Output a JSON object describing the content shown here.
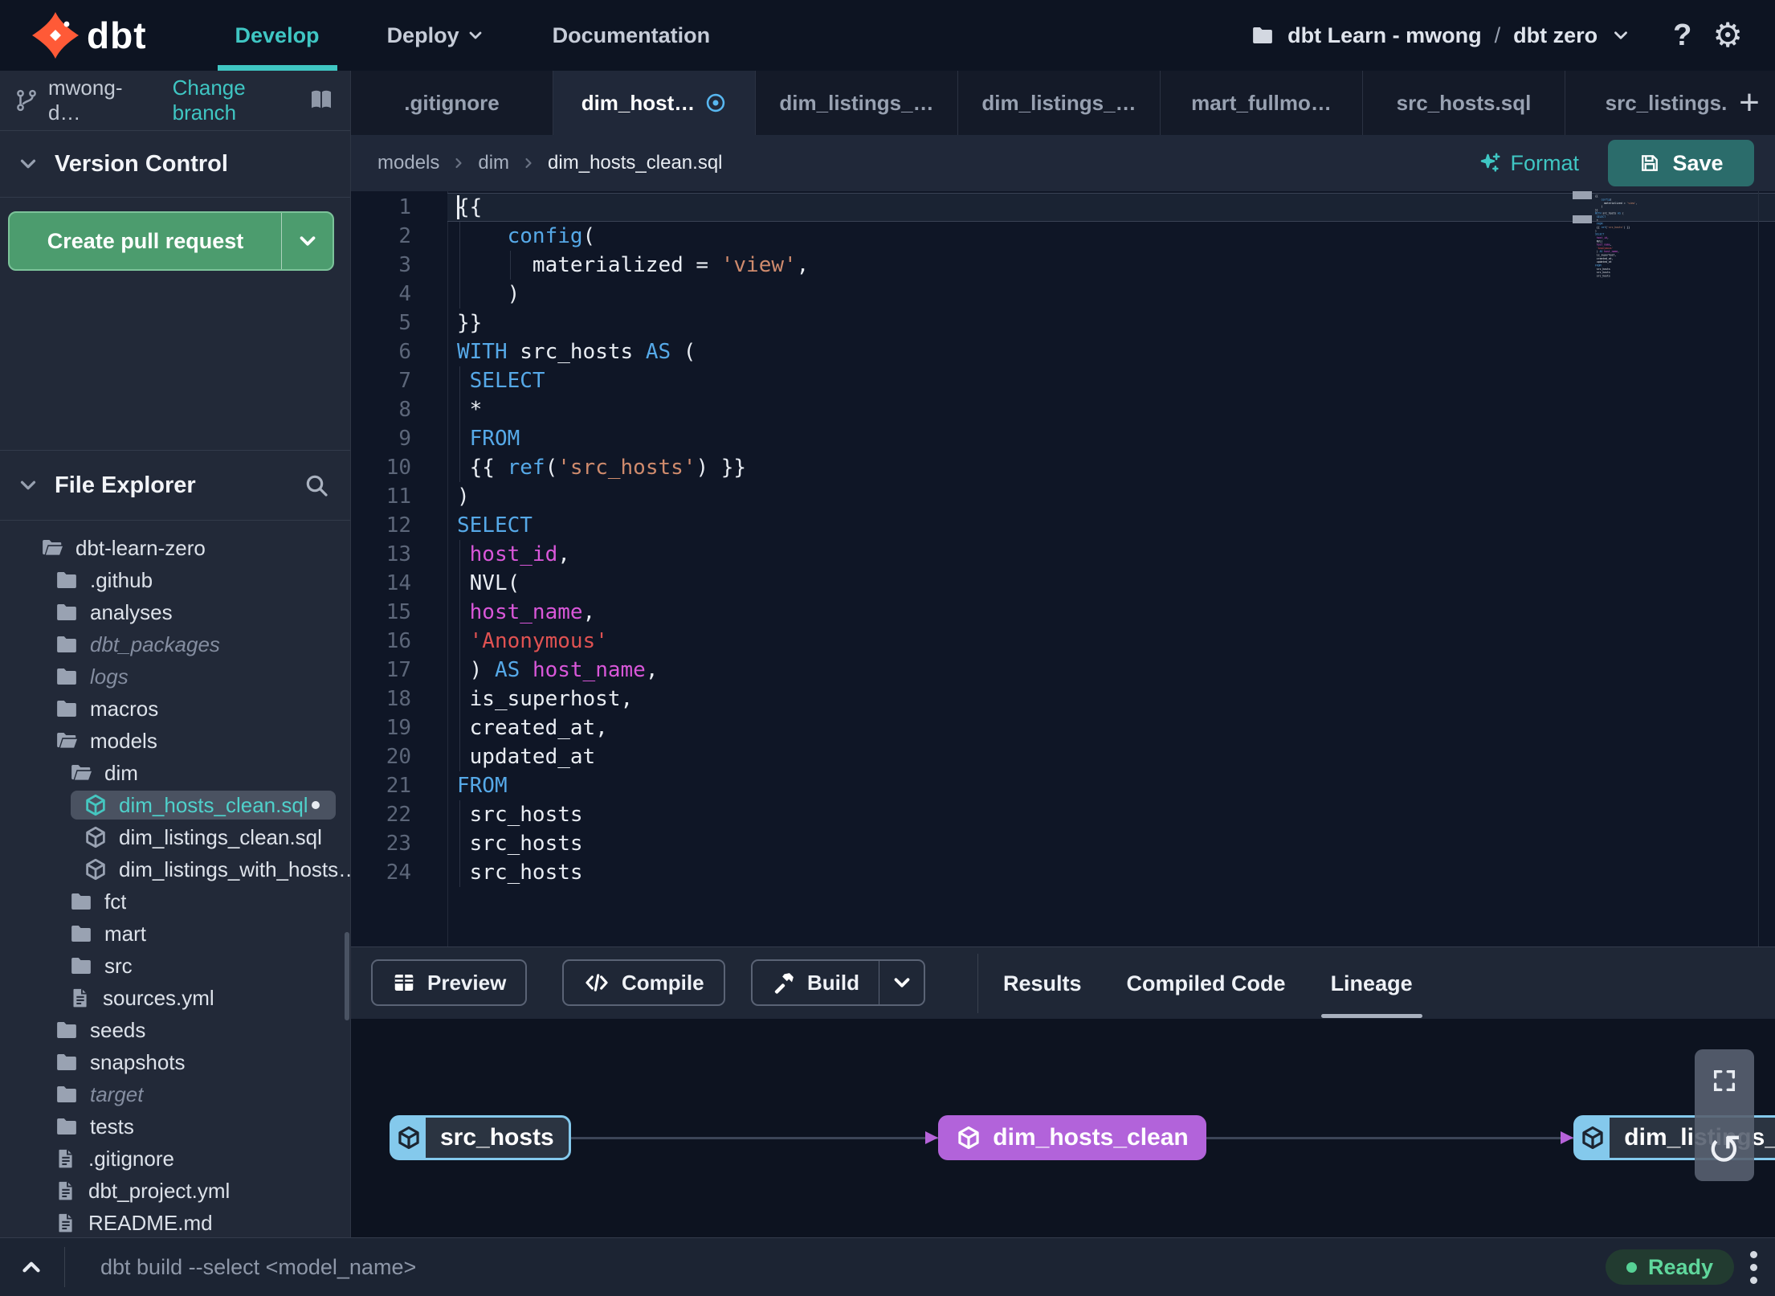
{
  "colors": {
    "accent_teal": "#3fc6c3",
    "brand_orange": "#ff5a37",
    "pr_green": "#4c9c6e",
    "ready_green": "#57d195",
    "node_blue": "#84c9ec",
    "node_purple": "#b263da",
    "modified_blue": "#58b7f0",
    "save_teal": "#2b6c6b"
  },
  "header": {
    "brand": "dbt",
    "nav": [
      {
        "label": "Develop",
        "active": true,
        "caret": false
      },
      {
        "label": "Deploy",
        "active": false,
        "caret": true
      },
      {
        "label": "Documentation",
        "active": false,
        "caret": false
      }
    ],
    "project": {
      "account": "dbt Learn - mwong",
      "separator": "/",
      "name": "dbt zero"
    },
    "help_label": "?"
  },
  "sidebar": {
    "branch": {
      "name": "mwong-d…",
      "change_link": "Change branch"
    },
    "version_control": {
      "title": "Version Control",
      "create_pr_label": "Create pull request"
    },
    "file_explorer": {
      "title": "File Explorer"
    },
    "tree": [
      {
        "label": "dbt-learn-zero",
        "level": 0,
        "icon": "folder-open"
      },
      {
        "label": ".github",
        "level": 1,
        "icon": "folder"
      },
      {
        "label": "analyses",
        "level": 1,
        "icon": "folder"
      },
      {
        "label": "dbt_packages",
        "level": 1,
        "icon": "folder",
        "dim": true
      },
      {
        "label": "logs",
        "level": 1,
        "icon": "folder",
        "dim": true
      },
      {
        "label": "macros",
        "level": 1,
        "icon": "folder"
      },
      {
        "label": "models",
        "level": 1,
        "icon": "folder-open"
      },
      {
        "label": "dim",
        "level": 2,
        "icon": "folder-open"
      },
      {
        "label": "dim_hosts_clean.sql",
        "level": 3,
        "icon": "model",
        "selected": true,
        "modified": true
      },
      {
        "label": "dim_listings_clean.sql",
        "level": 3,
        "icon": "model"
      },
      {
        "label": "dim_listings_with_hosts…",
        "level": 3,
        "icon": "model"
      },
      {
        "label": "fct",
        "level": 2,
        "icon": "folder"
      },
      {
        "label": "mart",
        "level": 2,
        "icon": "folder"
      },
      {
        "label": "src",
        "level": 2,
        "icon": "folder"
      },
      {
        "label": "sources.yml",
        "level": 2,
        "icon": "file"
      },
      {
        "label": "seeds",
        "level": 1,
        "icon": "folder"
      },
      {
        "label": "snapshots",
        "level": 1,
        "icon": "folder"
      },
      {
        "label": "target",
        "level": 1,
        "icon": "folder",
        "dim": true
      },
      {
        "label": "tests",
        "level": 1,
        "icon": "folder"
      },
      {
        "label": ".gitignore",
        "level": 1,
        "icon": "file"
      },
      {
        "label": "dbt_project.yml",
        "level": 1,
        "icon": "file"
      },
      {
        "label": "README.md",
        "level": 1,
        "icon": "file"
      }
    ]
  },
  "tabs": [
    {
      "label": ".gitignore"
    },
    {
      "label": "dim_host…",
      "active": true,
      "modified": true
    },
    {
      "label": "dim_listings_…"
    },
    {
      "label": "dim_listings_…"
    },
    {
      "label": "mart_fullmo…"
    },
    {
      "label": "src_hosts.sql"
    },
    {
      "label": "src_listings."
    }
  ],
  "add_tab_label": "+",
  "breadcrumb": [
    "models",
    "dim",
    "dim_hosts_clean.sql"
  ],
  "editor_actions": {
    "format": "Format",
    "save": "Save"
  },
  "editor": {
    "lines": [
      {
        "n": 1,
        "cur": true,
        "tokens": [
          [
            "w",
            "{{"
          ]
        ]
      },
      {
        "n": 2,
        "tokens": [
          [
            "w",
            "    "
          ],
          [
            "b",
            "config"
          ],
          [
            "w",
            "("
          ]
        ]
      },
      {
        "n": 3,
        "tokens": [
          [
            "w",
            "      materialized = "
          ],
          [
            "s",
            "'view'"
          ],
          [
            "w",
            ","
          ]
        ]
      },
      {
        "n": 4,
        "tokens": [
          [
            "w",
            "    )"
          ]
        ]
      },
      {
        "n": 5,
        "tokens": [
          [
            "w",
            "}}"
          ]
        ]
      },
      {
        "n": 6,
        "tokens": [
          [
            "b",
            "WITH"
          ],
          [
            "w",
            " src_hosts "
          ],
          [
            "b",
            "AS"
          ],
          [
            "w",
            " ("
          ]
        ]
      },
      {
        "n": 7,
        "tokens": [
          [
            "w",
            " "
          ],
          [
            "b",
            "SELECT"
          ]
        ]
      },
      {
        "n": 8,
        "tokens": [
          [
            "w",
            " *"
          ]
        ]
      },
      {
        "n": 9,
        "tokens": [
          [
            "w",
            " "
          ],
          [
            "b",
            "FROM"
          ]
        ]
      },
      {
        "n": 10,
        "tokens": [
          [
            "w",
            " {{ "
          ],
          [
            "b",
            "ref"
          ],
          [
            "w",
            "("
          ],
          [
            "s",
            "'src_hosts'"
          ],
          [
            "w",
            ") }}"
          ]
        ]
      },
      {
        "n": 11,
        "tokens": [
          [
            "w",
            ")"
          ]
        ]
      },
      {
        "n": 12,
        "tokens": [
          [
            "b",
            "SELECT"
          ]
        ]
      },
      {
        "n": 13,
        "tokens": [
          [
            "w",
            " "
          ],
          [
            "m",
            "host_id"
          ],
          [
            "w",
            ","
          ]
        ]
      },
      {
        "n": 14,
        "tokens": [
          [
            "w",
            " NVL("
          ]
        ]
      },
      {
        "n": 15,
        "tokens": [
          [
            "w",
            " "
          ],
          [
            "m",
            "host_name"
          ],
          [
            "w",
            ","
          ]
        ]
      },
      {
        "n": 16,
        "tokens": [
          [
            "w",
            " "
          ],
          [
            "r",
            "'Anonymous'"
          ]
        ]
      },
      {
        "n": 17,
        "tokens": [
          [
            "w",
            " ) "
          ],
          [
            "b",
            "AS"
          ],
          [
            "w",
            " "
          ],
          [
            "m",
            "host_name"
          ],
          [
            "w",
            ","
          ]
        ]
      },
      {
        "n": 18,
        "tokens": [
          [
            "w",
            " is_superhost,"
          ]
        ]
      },
      {
        "n": 19,
        "tokens": [
          [
            "w",
            " created_at,"
          ]
        ]
      },
      {
        "n": 20,
        "tokens": [
          [
            "w",
            " updated_at"
          ]
        ]
      },
      {
        "n": 21,
        "tokens": [
          [
            "b",
            "FROM"
          ]
        ]
      },
      {
        "n": 22,
        "tokens": [
          [
            "w",
            " src_hosts"
          ]
        ]
      },
      {
        "n": 23,
        "tokens": [
          [
            "w",
            " src_hosts"
          ]
        ]
      },
      {
        "n": 24,
        "tokens": [
          [
            "w",
            " src_hosts"
          ]
        ]
      }
    ]
  },
  "action_bar": {
    "buttons": [
      {
        "label": "Preview",
        "icon": "grid-icon"
      },
      {
        "label": "Compile",
        "icon": "code-icon"
      },
      {
        "label": "Build",
        "icon": "hammer-icon",
        "split": true
      }
    ],
    "tabs": [
      {
        "label": "Results"
      },
      {
        "label": "Compiled Code"
      },
      {
        "label": "Lineage",
        "active": true
      }
    ]
  },
  "lineage": {
    "nodes": [
      {
        "label": "src_hosts",
        "style": "blue"
      },
      {
        "label": "dim_hosts_clean",
        "style": "purple"
      },
      {
        "label": "dim_listings_with_h",
        "style": "blue"
      }
    ]
  },
  "command_bar": {
    "placeholder": "dbt build --select <model_name>",
    "status": "Ready"
  }
}
